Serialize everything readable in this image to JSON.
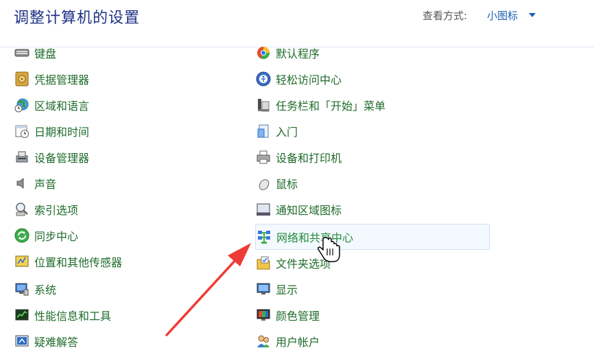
{
  "header": {
    "title": "调整计算机的设置",
    "view_label": "查看方式:",
    "view_value": "小图标"
  },
  "items_left": [
    {
      "label": "键盘",
      "icon": "keyboard-icon"
    },
    {
      "label": "凭据管理器",
      "icon": "credential-vault-icon"
    },
    {
      "label": "区域和语言",
      "icon": "globe-clock-icon"
    },
    {
      "label": "日期和时间",
      "icon": "calendar-clock-icon"
    },
    {
      "label": "设备管理器",
      "icon": "device-manager-icon"
    },
    {
      "label": "声音",
      "icon": "speaker-icon"
    },
    {
      "label": "索引选项",
      "icon": "magnifier-icon"
    },
    {
      "label": "同步中心",
      "icon": "sync-icon"
    },
    {
      "label": "位置和其他传感器",
      "icon": "sensor-icon"
    },
    {
      "label": "系统",
      "icon": "computer-icon"
    },
    {
      "label": "性能信息和工具",
      "icon": "performance-icon"
    },
    {
      "label": "疑难解答",
      "icon": "troubleshoot-icon"
    }
  ],
  "items_right": [
    {
      "label": "默认程序",
      "icon": "default-programs-icon"
    },
    {
      "label": "轻松访问中心",
      "icon": "ease-of-access-icon"
    },
    {
      "label": "任务栏和「开始」菜单",
      "icon": "taskbar-icon"
    },
    {
      "label": "入门",
      "icon": "getting-started-icon"
    },
    {
      "label": "设备和打印机",
      "icon": "printer-icon"
    },
    {
      "label": "鼠标",
      "icon": "mouse-icon"
    },
    {
      "label": "通知区域图标",
      "icon": "notification-area-icon"
    },
    {
      "label": "网络和共享中心",
      "icon": "network-icon"
    },
    {
      "label": "文件夹选项",
      "icon": "folder-options-icon"
    },
    {
      "label": "显示",
      "icon": "display-icon"
    },
    {
      "label": "颜色管理",
      "icon": "color-management-icon"
    },
    {
      "label": "用户帐户",
      "icon": "users-icon"
    }
  ],
  "colors": {
    "title": "#1e3287",
    "link": "#1e6b2a",
    "link_hover": "#1f8a3a",
    "accent": "#1a5fb4",
    "arrow": "#ef3b36"
  }
}
